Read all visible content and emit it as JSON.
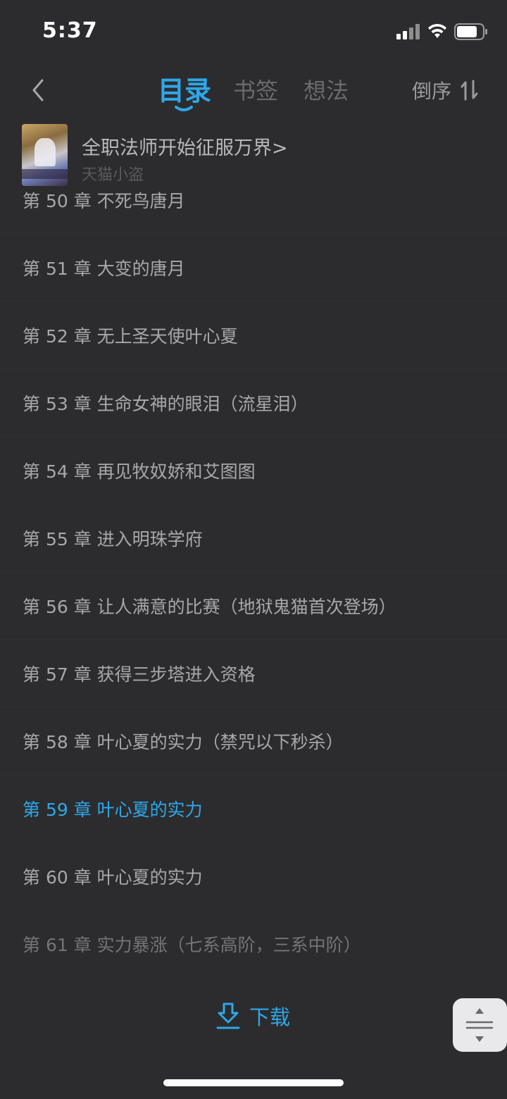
{
  "status_bar": {
    "time": "5:37"
  },
  "header": {
    "tabs": [
      {
        "label": "目录",
        "active": true
      },
      {
        "label": "书签",
        "active": false
      },
      {
        "label": "想法",
        "active": false
      }
    ],
    "sort_label": "倒序"
  },
  "book": {
    "title": "全职法师开始征服万界>",
    "author": "天猫小盗"
  },
  "chapters": [
    {
      "label": "第 50 章  不死鸟唐月"
    },
    {
      "label": "第 51 章  大变的唐月"
    },
    {
      "label": "第 52 章  无上圣天使叶心夏"
    },
    {
      "label": "第 53 章  生命女神的眼泪（流星泪）"
    },
    {
      "label": "第 54 章  再见牧奴娇和艾图图"
    },
    {
      "label": "第 55 章  进入明珠学府"
    },
    {
      "label": "第 56 章  让人满意的比赛（地狱鬼猫首次登场）"
    },
    {
      "label": "第 57 章  获得三步塔进入资格"
    },
    {
      "label": "第 58 章  叶心夏的实力（禁咒以下秒杀）"
    },
    {
      "label": "第 59 章  叶心夏的实力",
      "current": true
    },
    {
      "label": "第 60 章  叶心夏的实力"
    },
    {
      "label": "第 61 章  实力暴涨（七系高阶，三系中阶）",
      "dim": true
    }
  ],
  "download_label": "下载",
  "colors": {
    "background": "#2c2c2e",
    "accent": "#2ea7e9",
    "text": "#a8a8ab",
    "muted": "#6a6a6e"
  },
  "icons": {
    "back": "chevron-left-icon",
    "sort": "sort-arrows-icon",
    "download": "download-icon",
    "scroll": "scroll-handle-icon"
  }
}
